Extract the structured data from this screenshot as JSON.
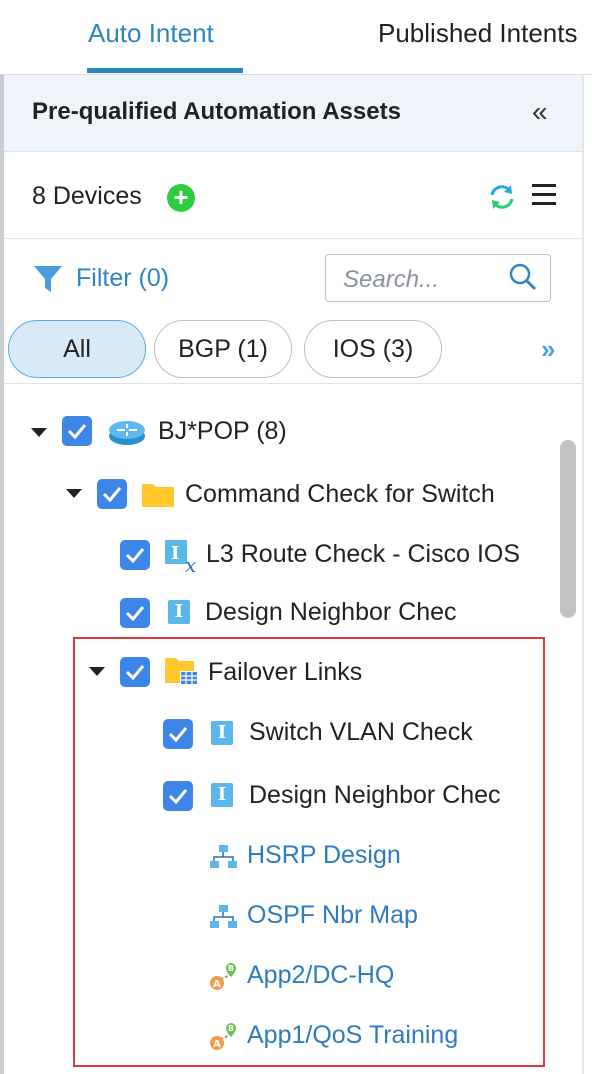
{
  "tabs": [
    {
      "label": "Auto Intent",
      "active": true
    },
    {
      "label": "Published Intents",
      "active": false
    }
  ],
  "panel": {
    "title": "Pre-qualified Automation Assets",
    "collapse_glyph": "«",
    "devices_label": "8 Devices",
    "filter_label": "Filter (0)",
    "search_placeholder": "Search...",
    "more_glyph": "»"
  },
  "pills": [
    {
      "label": "All",
      "selected": true
    },
    {
      "label": "BGP (1)",
      "selected": false
    },
    {
      "label": "IOS (3)",
      "selected": false
    }
  ],
  "tree": {
    "root": {
      "label": "BJ*POP (8)",
      "icon": "router-icon",
      "checked": true,
      "expanded": true
    },
    "group1": {
      "label": "Command Check for Switch",
      "icon": "folder-icon",
      "checked": true,
      "expanded": true
    },
    "group1_items": [
      {
        "label": "L3 Route Check - Cisco IOS",
        "icon": "intent-x-icon",
        "checked": true
      },
      {
        "label": "Design Neighbor Chec",
        "icon": "intent-icon",
        "checked": true
      }
    ],
    "group2": {
      "label": "Failover Links",
      "icon": "folder-table-icon",
      "checked": true,
      "expanded": true
    },
    "group2_items": [
      {
        "label": "Switch VLAN Check",
        "icon": "intent-icon",
        "checked": true
      },
      {
        "label": "Design Neighbor Chec",
        "icon": "intent-icon",
        "checked": true
      }
    ],
    "group2_links": [
      {
        "label": "HSRP Design",
        "icon": "topology-icon"
      },
      {
        "label": "OSPF Nbr Map",
        "icon": "topology-icon"
      },
      {
        "label": "App2/DC-HQ",
        "icon": "path-icon"
      },
      {
        "label": "App1/QoS Training",
        "icon": "path-icon"
      }
    ]
  },
  "colors": {
    "accent": "#2e86c1",
    "checkbox": "#3d86e8",
    "highlight_border": "#d9363e",
    "add_button": "#2ecc40"
  }
}
